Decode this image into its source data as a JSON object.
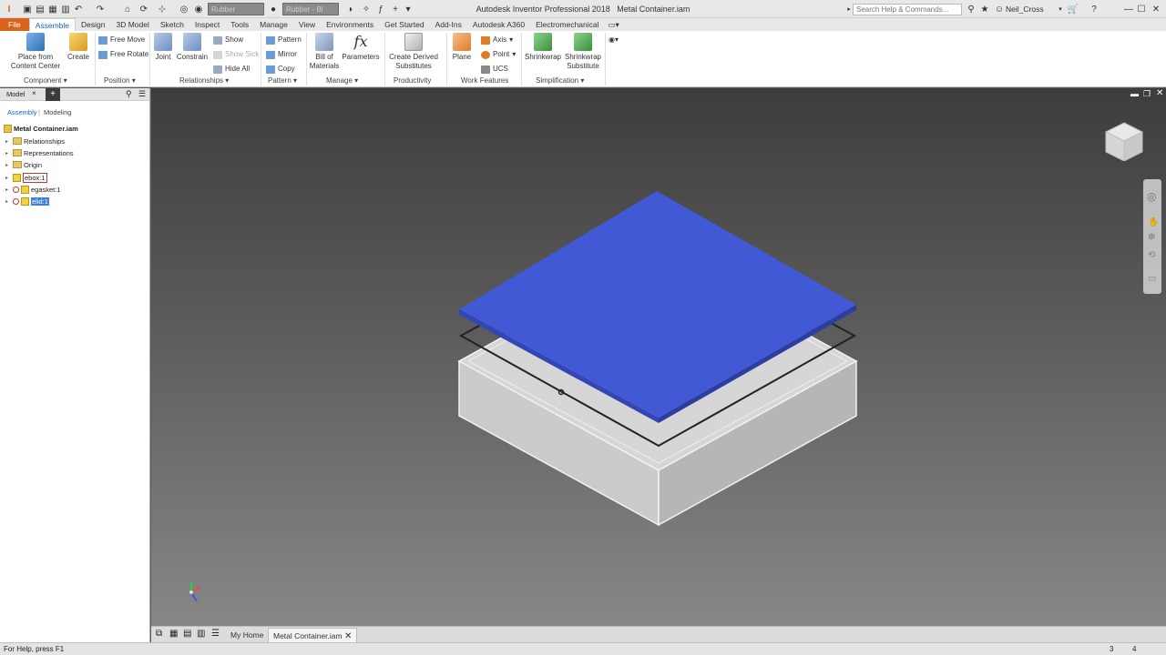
{
  "app": {
    "title": "Autodesk Inventor Professional 2018",
    "document": "Metal Container.iam"
  },
  "quick_access": {
    "material": "Rubber",
    "appearance": "Rubber - Bl"
  },
  "search": {
    "placeholder": "Search Help & Commands..."
  },
  "user": {
    "name": "Neil_Cross"
  },
  "menu_tabs": [
    "File",
    "Assemble",
    "Design",
    "3D Model",
    "Sketch",
    "Inspect",
    "Tools",
    "Manage",
    "View",
    "Environments",
    "Get Started",
    "Add-Ins",
    "Autodesk A360",
    "Electromechanical"
  ],
  "active_tab": "Assemble",
  "ribbon": {
    "place_from": "Place from",
    "content_center": "Content Center",
    "create": "Create",
    "free_move": "Free Move",
    "free_rotate": "Free Rotate",
    "joint": "Joint",
    "constrain": "Constrain",
    "show": "Show",
    "show_sick": "Show Sick",
    "hide_all": "Hide All",
    "pattern": "Pattern",
    "mirror": "Mirror",
    "copy": "Copy",
    "bill_of": "Bill of",
    "materials": "Materials",
    "parameters": "Parameters",
    "create_derived": "Create Derived",
    "substitutes": "Substitutes",
    "plane": "Plane",
    "axis": "Axis",
    "point": "Point",
    "ucs": "UCS",
    "shrinkwrap": "Shrinkwrap",
    "shrinkwrap_sub_1": "Shrinkwrap",
    "shrinkwrap_sub_2": "Substitute",
    "groups": {
      "component": "Component",
      "position": "Position",
      "relationships": "Relationships",
      "pattern": "Pattern",
      "manage": "Manage",
      "productivity": "Productivity",
      "work_features": "Work Features",
      "simplification": "Simplification"
    }
  },
  "browser": {
    "tab_model": "Model",
    "mode_assembly": "Assembly",
    "mode_modeling": "Modeling",
    "root": "Metal Container.iam",
    "items": {
      "relationships": "Relationships",
      "representations": "Representations",
      "origin": "Origin",
      "ebox": "ebox:1",
      "egasket": "egasket:1",
      "elid": "elid:1"
    }
  },
  "doc_tabs": {
    "home": "My Home",
    "doc": "Metal Container.iam"
  },
  "status": {
    "help": "For Help, press F1",
    "count1": "3",
    "count2": "4"
  },
  "colors": {
    "accent": "#1a63b5",
    "file_tab": "#d8641c",
    "lid": "#4259d6",
    "selection": "#3d7fd9"
  }
}
